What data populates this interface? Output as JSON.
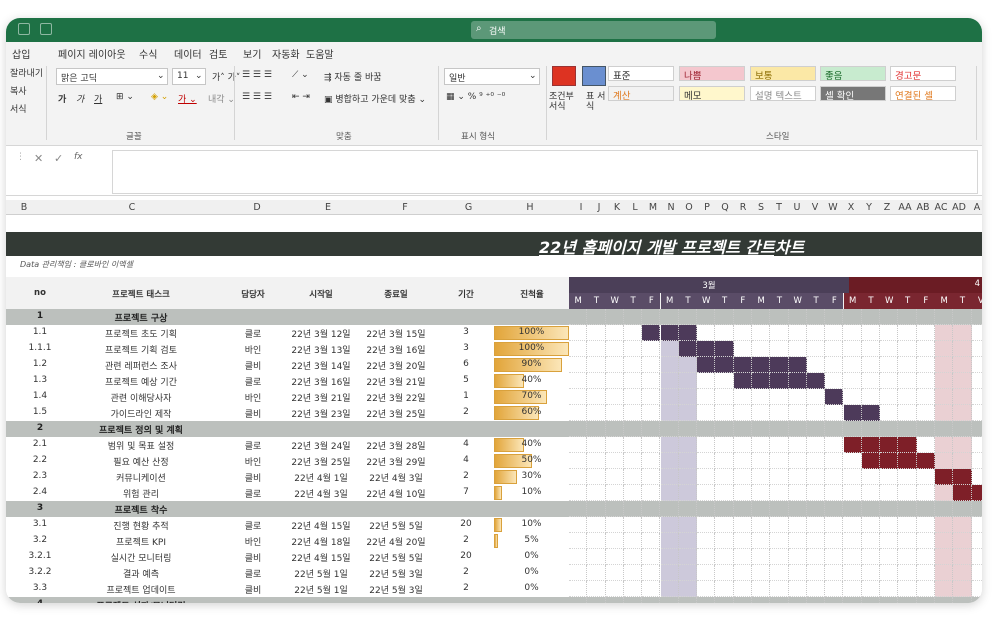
{
  "menu": [
    "삽입",
    "페이지 레이아웃",
    "수식",
    "데이터",
    "검토",
    "보기",
    "자동화",
    "도움말"
  ],
  "ribbon": {
    "font_name": "맑은 고딕",
    "font_size": "11",
    "wrap_text": "자동 줄 바꿈",
    "merge_center": "병합하고 가운데 맞춤",
    "number_format": "일반",
    "cond_format": "조건부 서식",
    "table_format": "표 서식",
    "groups": [
      "글꼴",
      "맞춤",
      "표시 형식",
      "스타일"
    ],
    "styles": [
      {
        "label": "표준",
        "bg": "#ffffff",
        "fg": "#222222"
      },
      {
        "label": "나쁨",
        "bg": "#f4c7ce",
        "fg": "#9c1f2e"
      },
      {
        "label": "보통",
        "bg": "#fbe8a6",
        "fg": "#8a6b00"
      },
      {
        "label": "좋음",
        "bg": "#c8ebcf",
        "fg": "#1c6b2c"
      },
      {
        "label": "경고문",
        "bg": "#ffffff",
        "fg": "#e03030"
      },
      {
        "label": "계산",
        "bg": "#f2f2f2",
        "fg": "#e07a1f"
      },
      {
        "label": "메모",
        "bg": "#fff7cc",
        "fg": "#333333"
      },
      {
        "label": "설명 텍스트",
        "bg": "#ffffff",
        "fg": "#888888"
      },
      {
        "label": "셀 확인",
        "bg": "#777777",
        "fg": "#ffffff"
      },
      {
        "label": "연결된 셀",
        "bg": "#ffffff",
        "fg": "#e07a1f"
      }
    ],
    "left_labels": [
      "잘라내기",
      "복사",
      "서식"
    ]
  },
  "formula_bar": {
    "cancel": "✕",
    "confirm": "✓",
    "fx": "fx"
  },
  "columns": [
    "B",
    "C",
    "D",
    "E",
    "F",
    "G",
    "H",
    "I",
    "J",
    "K",
    "L",
    "M",
    "N",
    "O",
    "P",
    "Q",
    "R",
    "S",
    "T",
    "U",
    "V",
    "W",
    "X",
    "Y",
    "Z",
    "AA",
    "AB",
    "AC",
    "AD",
    "A"
  ],
  "sheet": {
    "title": "22년 홈페이지 개발 프로젝트 간트차트",
    "managers": "Data 관리책임 : 클로바인 이엑셀",
    "headers": {
      "no": "no",
      "task": "프로젝트 태스크",
      "owner": "담당자",
      "start": "시작일",
      "end": "종료일",
      "duration": "기간",
      "progress": "진척율"
    },
    "month1": "3월",
    "month2": "4",
    "days": [
      "M",
      "T",
      "W",
      "T",
      "F",
      "M",
      "T",
      "W",
      "T",
      "F",
      "M",
      "T",
      "W",
      "T",
      "F",
      "M",
      "T",
      "W",
      "T",
      "F",
      "M",
      "T",
      "V"
    ],
    "rows": [
      {
        "section": true,
        "no": "1",
        "task": "프로젝트 구상"
      },
      {
        "no": "1.1",
        "task": "프로젝트 초도 기획",
        "owner": "클로",
        "start": "22년 3월 12일",
        "end": "22년 3월 15일",
        "duration": "3",
        "progress": "100%",
        "pct": 1.0,
        "gantt": [
          4,
          5,
          6
        ],
        "color": 1
      },
      {
        "no": "1.1.1",
        "task": "프로젝트 기획 검토",
        "owner": "바인",
        "start": "22년 3월 13일",
        "end": "22년 3월 16일",
        "duration": "3",
        "progress": "100%",
        "pct": 1.0,
        "gantt": [
          6,
          7,
          8
        ],
        "color": 1
      },
      {
        "no": "1.2",
        "task": "관련 레퍼런스 조사",
        "owner": "클비",
        "start": "22년 3월 14일",
        "end": "22년 3월 20일",
        "duration": "6",
        "progress": "90%",
        "pct": 0.9,
        "gantt": [
          7,
          8,
          9,
          10,
          11,
          12
        ],
        "color": 1
      },
      {
        "no": "1.3",
        "task": "프로젝트 예상 기간",
        "owner": "클로",
        "start": "22년 3월 16일",
        "end": "22년 3월 21일",
        "duration": "5",
        "progress": "40%",
        "pct": 0.4,
        "gantt": [
          9,
          10,
          11,
          12,
          13
        ],
        "color": 1
      },
      {
        "no": "1.4",
        "task": "관련 이해당사자",
        "owner": "바인",
        "start": "22년 3월 21일",
        "end": "22년 3월 22일",
        "duration": "1",
        "progress": "70%",
        "pct": 0.7,
        "gantt": [
          14
        ],
        "color": 1
      },
      {
        "no": "1.5",
        "task": "가이드라인 제작",
        "owner": "클비",
        "start": "22년 3월 23일",
        "end": "22년 3월 25일",
        "duration": "2",
        "progress": "60%",
        "pct": 0.6,
        "gantt": [
          15,
          16
        ],
        "color": 1
      },
      {
        "section": true,
        "no": "2",
        "task": "프로젝트 정의 및 계획"
      },
      {
        "no": "2.1",
        "task": "범위 및 목표 설정",
        "owner": "클로",
        "start": "22년 3월 24일",
        "end": "22년 3월 28일",
        "duration": "4",
        "progress": "40%",
        "pct": 0.4,
        "gantt": [
          15,
          16,
          17,
          18
        ],
        "color": 2
      },
      {
        "no": "2.2",
        "task": "필요 예산 산정",
        "owner": "바인",
        "start": "22년 3월 25일",
        "end": "22년 3월 29일",
        "duration": "4",
        "progress": "50%",
        "pct": 0.5,
        "gantt": [
          16,
          17,
          18,
          19
        ],
        "color": 2
      },
      {
        "no": "2.3",
        "task": "커뮤니케이션",
        "owner": "클비",
        "start": "22년 4월 1일",
        "end": "22년 4월 3일",
        "duration": "2",
        "progress": "30%",
        "pct": 0.3,
        "gantt": [
          20,
          21
        ],
        "color": 2
      },
      {
        "no": "2.4",
        "task": "위험 관리",
        "owner": "클로",
        "start": "22년 4월 3일",
        "end": "22년 4월 10일",
        "duration": "7",
        "progress": "10%",
        "pct": 0.1,
        "gantt": [
          21,
          22
        ],
        "color": 2
      },
      {
        "section": true,
        "no": "3",
        "task": "프로젝트 착수"
      },
      {
        "no": "3.1",
        "task": "진행 현황 추적",
        "owner": "클로",
        "start": "22년 4월 15일",
        "end": "22년 5월 5일",
        "duration": "20",
        "progress": "10%",
        "pct": 0.1,
        "gantt": [],
        "color": 2
      },
      {
        "no": "3.2",
        "task": "프로젝트 KPI",
        "owner": "바인",
        "start": "22년 4월 18일",
        "end": "22년 4월 20일",
        "duration": "2",
        "progress": "5%",
        "pct": 0.05,
        "gantt": [],
        "color": 2
      },
      {
        "no": "3.2.1",
        "task": "실시간 모니터링",
        "owner": "클비",
        "start": "22년 4월 15일",
        "end": "22년 5월 5일",
        "duration": "20",
        "progress": "0%",
        "pct": 0.0,
        "gantt": [],
        "color": 2
      },
      {
        "no": "3.2.2",
        "task": "결과 예측",
        "owner": "클로",
        "start": "22년 5월 1일",
        "end": "22년 5월 3일",
        "duration": "2",
        "progress": "0%",
        "pct": 0.0,
        "gantt": [],
        "color": 2
      },
      {
        "no": "3.3",
        "task": "프로젝트 업데이트",
        "owner": "클비",
        "start": "22년 5월 1일",
        "end": "22년 5월 3일",
        "duration": "2",
        "progress": "0%",
        "pct": 0.0,
        "gantt": [],
        "color": 2
      },
      {
        "section": true,
        "no": "4",
        "task": "프로젝트 성과/모니터링"
      }
    ]
  }
}
